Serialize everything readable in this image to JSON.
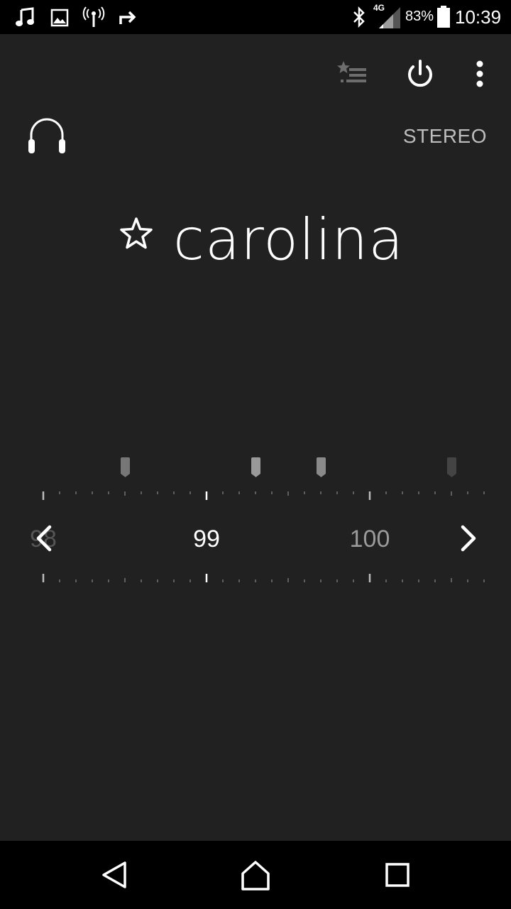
{
  "status_bar": {
    "network": "4G",
    "battery_percent": "83%",
    "time": "10:39",
    "icons": [
      "music-note-icon",
      "image-icon",
      "broadcast-icon",
      "share-forward-icon",
      "bluetooth-icon",
      "signal-icon",
      "battery-icon"
    ]
  },
  "toolbar": {
    "favorites_icon": "favorites-list-icon",
    "power_icon": "power-icon",
    "menu_icon": "more-vert-icon"
  },
  "audio": {
    "output_icon": "headphones-icon",
    "mode": "STEREO"
  },
  "station": {
    "favorite_icon": "star-outline-icon",
    "name": "carolina"
  },
  "tuner": {
    "frequency_labels": [
      "98",
      "99",
      "100"
    ],
    "prev_icon": "chevron-left-icon",
    "next_icon": "chevron-right-icon"
  },
  "nav_bar": {
    "icons": [
      "back-icon",
      "home-icon",
      "recents-icon"
    ]
  }
}
